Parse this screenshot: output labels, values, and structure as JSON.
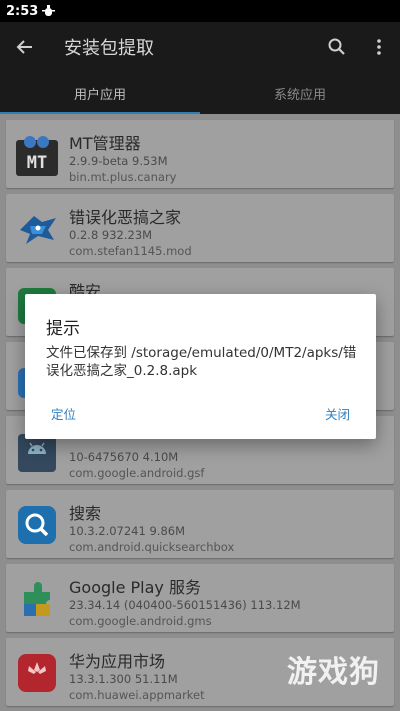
{
  "statusbar": {
    "time": "2:53"
  },
  "toolbar": {
    "title": "安装包提取"
  },
  "tabs": [
    {
      "label": "用户应用",
      "active": true
    },
    {
      "label": "系统应用",
      "active": false
    }
  ],
  "apps": [
    {
      "name": "MT管理器",
      "meta": "2.9.9-beta   9.53M",
      "pkg": "bin.mt.plus.canary",
      "icon": "mt-manager-icon"
    },
    {
      "name": "错误化恶搞之家",
      "meta": "0.2.8   932.23M",
      "pkg": "com.stefan1145.mod",
      "icon": "bird-game-icon"
    },
    {
      "name": "酷安",
      "meta": "",
      "pkg": "",
      "icon": "coolapk-icon"
    },
    {
      "name": "",
      "meta": "",
      "pkg": "",
      "icon": "blue-app-icon"
    },
    {
      "name": "",
      "meta": "10-6475670   4.10M",
      "pkg": "com.google.android.gsf",
      "icon": "android-icon"
    },
    {
      "name": "搜索",
      "meta": "10.3.2.07241   9.86M",
      "pkg": "com.android.quicksearchbox",
      "icon": "search-app-icon"
    },
    {
      "name": "Google Play 服务",
      "meta": "23.34.14 (040400-560151436)   113.12M",
      "pkg": "com.google.android.gms",
      "icon": "google-play-services-icon"
    },
    {
      "name": "华为应用市场",
      "meta": "13.3.1.300   51.11M",
      "pkg": "com.huawei.appmarket",
      "icon": "huawei-appgallery-icon"
    }
  ],
  "dialog": {
    "title": "提示",
    "message": "文件已保存到 /storage/emulated/0/MT2/apks/错误化恶搞之家_0.2.8.apk",
    "left_button": "定位",
    "right_button": "关闭"
  },
  "watermark": {
    "text": "游戏狗"
  },
  "colors": {
    "accent": "#2e7eb5",
    "dialog_button": "#2f7fc0",
    "toolbar": "#1a1a1a"
  }
}
